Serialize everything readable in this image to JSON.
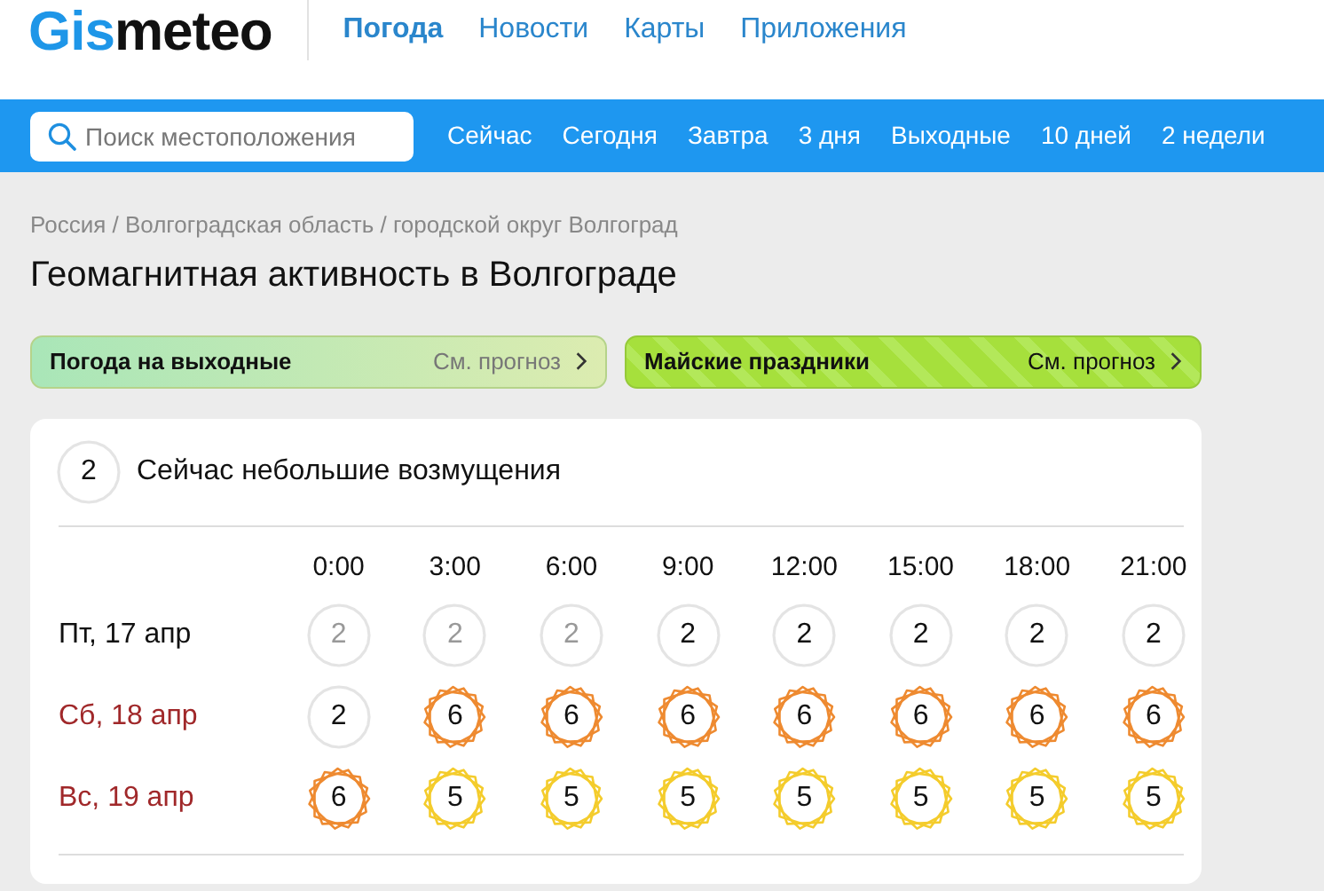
{
  "logo": {
    "part1": "Gis",
    "part2": "meteo"
  },
  "nav": [
    {
      "label": "Погода",
      "selected": true
    },
    {
      "label": "Новости",
      "selected": false
    },
    {
      "label": "Карты",
      "selected": false
    },
    {
      "label": "Приложения",
      "selected": false
    }
  ],
  "search": {
    "placeholder": "Поиск местоположения"
  },
  "subnav": [
    "Сейчас",
    "Сегодня",
    "Завтра",
    "3 дня",
    "Выходные",
    "10 дней",
    "2 недели"
  ],
  "breadcrumbs": [
    "Россия",
    "Волгоградская область",
    "городской округ Волгоград"
  ],
  "breadcrumb_separator": "/",
  "title": "Геомагнитная активность в Волгограде",
  "promos": [
    {
      "title": "Погода на выходные",
      "link": "См. прогноз",
      "kind": "plain"
    },
    {
      "title": "Майские праздники",
      "link": "См. прогноз",
      "kind": "pattern"
    }
  ],
  "current": {
    "value": "2",
    "text": "Сейчас небольшие возмущения"
  },
  "table": {
    "columns": [
      "0:00",
      "3:00",
      "6:00",
      "9:00",
      "12:00",
      "15:00",
      "18:00",
      "21:00"
    ],
    "rows": [
      {
        "day": "Пт, 17 апр",
        "weekend": false,
        "cells": [
          {
            "value": "2",
            "past": true,
            "color": "#e4e4e4"
          },
          {
            "value": "2",
            "past": true,
            "color": "#e4e4e4"
          },
          {
            "value": "2",
            "past": true,
            "color": "#e4e4e4"
          },
          {
            "value": "2",
            "past": false,
            "color": "#e4e4e4"
          },
          {
            "value": "2",
            "past": false,
            "color": "#e4e4e4"
          },
          {
            "value": "2",
            "past": false,
            "color": "#e4e4e4"
          },
          {
            "value": "2",
            "past": false,
            "color": "#e4e4e4"
          },
          {
            "value": "2",
            "past": false,
            "color": "#e4e4e4"
          }
        ]
      },
      {
        "day": "Сб, 18 апр",
        "weekend": true,
        "cells": [
          {
            "value": "2",
            "past": false,
            "color": "#e4e4e4"
          },
          {
            "value": "6",
            "past": false,
            "color": "#ee8a30"
          },
          {
            "value": "6",
            "past": false,
            "color": "#ee8a30"
          },
          {
            "value": "6",
            "past": false,
            "color": "#ee8a30"
          },
          {
            "value": "6",
            "past": false,
            "color": "#ee8a30"
          },
          {
            "value": "6",
            "past": false,
            "color": "#ee8a30"
          },
          {
            "value": "6",
            "past": false,
            "color": "#ee8a30"
          },
          {
            "value": "6",
            "past": false,
            "color": "#ee8a30"
          }
        ]
      },
      {
        "day": "Вс, 19 апр",
        "weekend": true,
        "cells": [
          {
            "value": "6",
            "past": false,
            "color": "#ee8a30"
          },
          {
            "value": "5",
            "past": false,
            "color": "#f4cc2c"
          },
          {
            "value": "5",
            "past": false,
            "color": "#f4cc2c"
          },
          {
            "value": "5",
            "past": false,
            "color": "#f4cc2c"
          },
          {
            "value": "5",
            "past": false,
            "color": "#f4cc2c"
          },
          {
            "value": "5",
            "past": false,
            "color": "#f4cc2c"
          },
          {
            "value": "5",
            "past": false,
            "color": "#f4cc2c"
          },
          {
            "value": "5",
            "past": false,
            "color": "#f4cc2c"
          }
        ]
      }
    ]
  }
}
